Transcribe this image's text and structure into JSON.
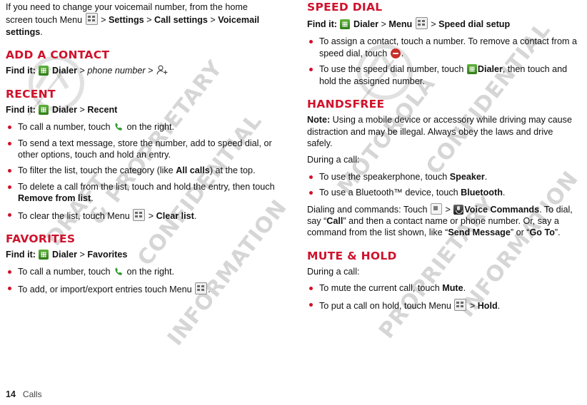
{
  "document": {
    "footer_page": "14",
    "footer_chapter": "Calls",
    "watermark": "DRAFT MOTOROLA CONFIDENTIAL & PROPRIETARY INFORMATION"
  },
  "left_column": {
    "intro_paragraph_parts": {
      "p1": "If you need to change your voicemail number, from the home screen touch Menu ",
      "p2": " > ",
      "settings": "Settings",
      "p3": " > ",
      "call_settings": "Call settings",
      "p4": " > ",
      "voicemail_settings": "Voicemail settings",
      "p5": "."
    },
    "sections": [
      {
        "heading": "ADD A CONTACT",
        "find_it": {
          "label": "Find it:",
          "app": "Dialer",
          "sep1": ">",
          "target_italic": "phone number",
          "sep2": ">"
        }
      },
      {
        "heading": "RECENT",
        "find_it": {
          "label": "Find it:",
          "app": "Dialer",
          "sep1": ">",
          "target": "Recent"
        },
        "bullets": [
          {
            "pre": "To call a number, touch ",
            "post": " on the right."
          },
          {
            "pre": "To send a text message, store the number, add to speed dial, or other options, touch and hold an entry."
          },
          {
            "pre": "To filter the list, touch the category (like ",
            "bold": "All calls",
            "post": ") at the top."
          },
          {
            "pre": "To delete a call from the list, touch and hold the entry, then touch ",
            "bold": "Remove from list",
            "post": "."
          },
          {
            "pre": "To clear the list, touch Menu ",
            "mid": " > ",
            "bold": "Clear list",
            "post": "."
          }
        ]
      },
      {
        "heading": "FAVORITES",
        "find_it": {
          "label": "Find it:",
          "app": "Dialer",
          "sep1": ">",
          "target": "Favorites"
        },
        "bullets": [
          {
            "pre": "To call a number, touch ",
            "post": " on the right."
          },
          {
            "pre": "To add, or import/export entries touch Menu ",
            "post": "."
          }
        ]
      }
    ]
  },
  "right_column": {
    "sections": [
      {
        "heading": "SPEED DIAL",
        "find_it": {
          "label": "Find it:",
          "app": "Dialer",
          "sep1": ">",
          "menu": "Menu",
          "sep2": ">",
          "target": "Speed dial setup"
        },
        "bullets": [
          {
            "pre": "To assign a contact, touch a number. To remove a contact from a speed dial, touch ",
            "post": "."
          },
          {
            "pre": "To use the speed dial number, touch ",
            "bold": "Dialer",
            "post": ", then touch and hold the assigned number."
          }
        ]
      },
      {
        "heading": "HANDSFREE",
        "note_label": "Note:",
        "note_text": " Using a mobile device or accessory while driving may cause distraction and may be illegal. Always obey the laws and drive safely.",
        "during_call": "During a call:",
        "bullets": [
          {
            "pre": "To use the speakerphone, touch ",
            "bold": "Speaker",
            "post": "."
          },
          {
            "pre": "To use a Bluetooth™ device, touch ",
            "bold": "Bluetooth",
            "post": "."
          }
        ],
        "dialing_paragraph": {
          "p1": "Dialing and commands: Touch ",
          "p2": " > ",
          "bold1": "Voice Commands",
          "p3": ". To dial, say “",
          "bold2": "Call",
          "p4": "” and then a contact name or phone number. Or, say a command from the list shown, like “",
          "bold3": "Send Message",
          "p5": "” or “",
          "bold4": "Go To",
          "p6": "”."
        }
      },
      {
        "heading": "MUTE & HOLD",
        "during_call": "During a call:",
        "bullets": [
          {
            "pre": "To mute the current call, touch ",
            "bold": "Mute",
            "post": "."
          },
          {
            "pre": "To put a call on hold, touch Menu ",
            "mid": " > ",
            "bold": "Hold",
            "post": "."
          }
        ]
      }
    ]
  }
}
